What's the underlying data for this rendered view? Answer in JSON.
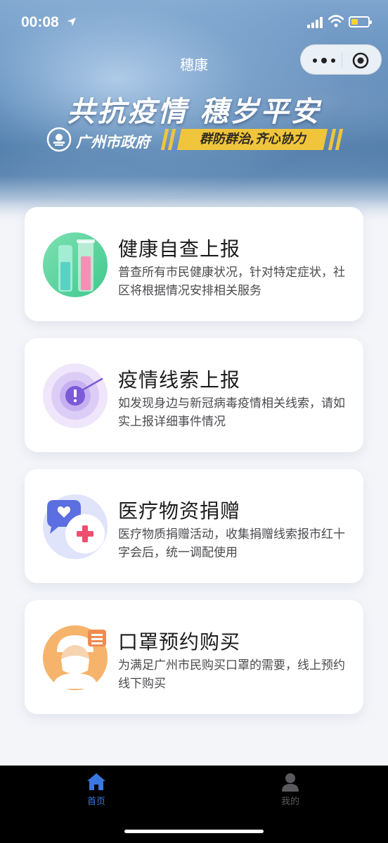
{
  "status_bar": {
    "time": "00:08"
  },
  "nav": {
    "title": "穗康"
  },
  "banner": {
    "title": "共抗疫情 穗岁平安",
    "gov_name": "广州市政府",
    "slogan": "群防群治,齐心协力"
  },
  "cards": [
    {
      "title": "健康自查上报",
      "desc": "普查所有市民健康状况，针对特定症状，社区将根据情况安排相关服务",
      "icon": "test-tubes-icon"
    },
    {
      "title": "疫情线索上报",
      "desc": "如发现身边与新冠病毒疫情相关线索，请如实上报详细事件情况",
      "icon": "alert-radar-icon"
    },
    {
      "title": "医疗物资捐赠",
      "desc": "医疗物质捐赠活动，收集捐赠线索报市红十字会后，统一调配使用",
      "icon": "donation-chat-icon"
    },
    {
      "title": "口罩预约购买",
      "desc": "为满足广州市民购买口罩的需要，线上预约线下购买",
      "icon": "mask-doctor-icon"
    }
  ],
  "tabbar": {
    "home_label": "首页",
    "mine_label": "我的",
    "active_color": "#3a78e0",
    "inactive_color": "#5a5a5e"
  },
  "colors": {
    "slogan_bg": "#f0c53c",
    "card_bg": "#ffffff",
    "page_bg": "#f4f5f9"
  }
}
